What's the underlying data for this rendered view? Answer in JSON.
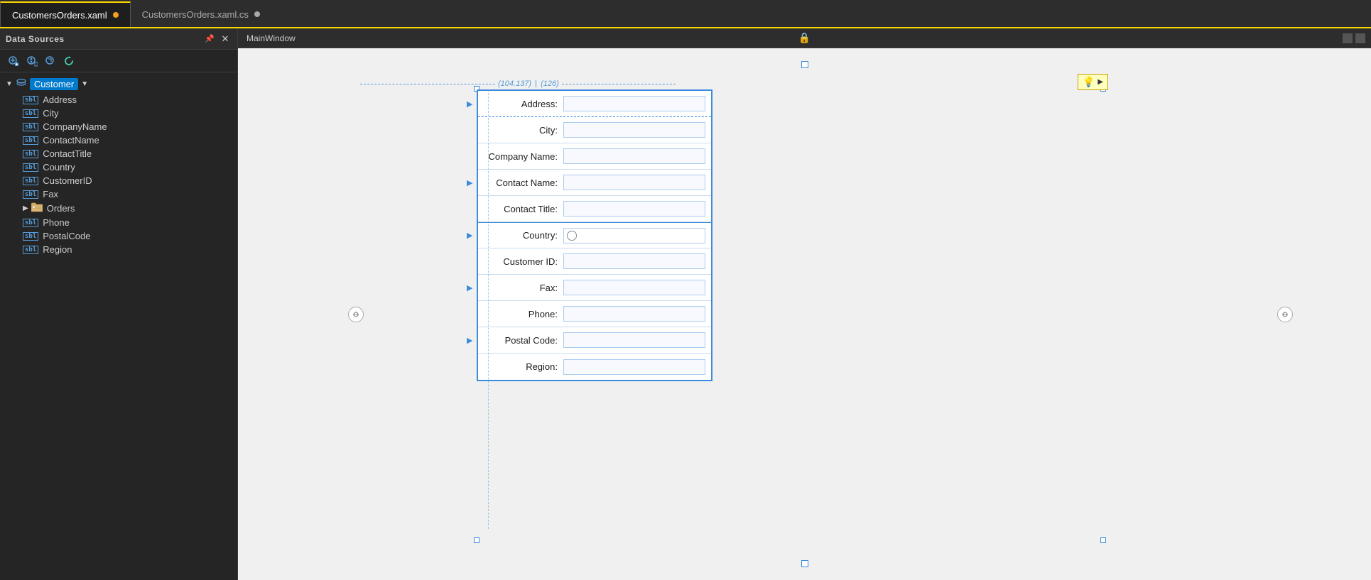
{
  "tabs": [
    {
      "id": "xaml",
      "label": "CustomersOrders.xaml",
      "active": true,
      "modified": true
    },
    {
      "id": "cs",
      "label": "CustomersOrders.xaml.cs",
      "active": false,
      "modified": false
    }
  ],
  "panel": {
    "title": "Data Sources",
    "toolbar_buttons": [
      "add",
      "edit",
      "refresh_schema",
      "refresh"
    ]
  },
  "tree": {
    "root": {
      "label": "Customer",
      "icon": "database",
      "expanded": true
    },
    "fields": [
      {
        "name": "Address",
        "type": "sbl"
      },
      {
        "name": "City",
        "type": "sbl"
      },
      {
        "name": "CompanyName",
        "type": "sbl"
      },
      {
        "name": "ContactName",
        "type": "sbl"
      },
      {
        "name": "ContactTitle",
        "type": "sbl"
      },
      {
        "name": "Country",
        "type": "sbl"
      },
      {
        "name": "CustomerID",
        "type": "sbl"
      },
      {
        "name": "Fax",
        "type": "sbl"
      },
      {
        "name": "Orders",
        "type": "folder",
        "expandable": true
      },
      {
        "name": "Phone",
        "type": "sbl"
      },
      {
        "name": "PostalCode",
        "type": "sbl"
      },
      {
        "name": "Region",
        "type": "sbl"
      }
    ]
  },
  "designer": {
    "window_title": "MainWindow",
    "measure_left": "(104.137)",
    "measure_right": "(126)",
    "form_fields": [
      {
        "label": "Address:",
        "type": "text",
        "selected": true
      },
      {
        "label": "City:",
        "type": "text",
        "selected": false
      },
      {
        "label": "Company Name:",
        "type": "text",
        "selected": false
      },
      {
        "label": "Contact Name:",
        "type": "text",
        "selected": false
      },
      {
        "label": "Contact Title:",
        "type": "text",
        "selected": false
      },
      {
        "label": "Country:",
        "type": "radio",
        "selected": false
      },
      {
        "label": "Customer ID:",
        "type": "text",
        "selected": false
      },
      {
        "label": "Fax:",
        "type": "text",
        "selected": false
      },
      {
        "label": "Phone:",
        "type": "text",
        "selected": false
      },
      {
        "label": "Postal Code:",
        "type": "text",
        "selected": false
      },
      {
        "label": "Region:",
        "type": "text",
        "selected": false
      }
    ]
  }
}
